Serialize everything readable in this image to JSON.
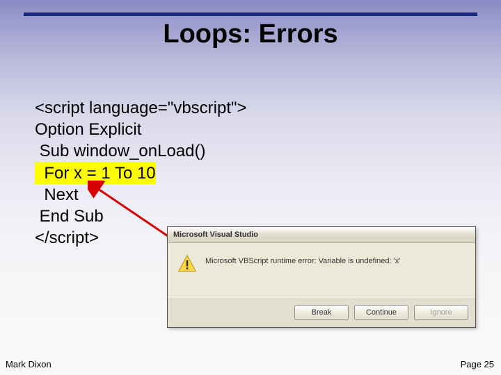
{
  "title": "Loops: Errors",
  "code": {
    "l1": "<script language=\"vbscript\">",
    "l2": "Option Explicit",
    "l3": "",
    "l4": " Sub window_onLoad()",
    "l5_hl": "  For x = 1 To 10",
    "l6": "  Next",
    "l7": " End Sub",
    "l8": "</script>"
  },
  "dialog": {
    "title": "Microsoft Visual Studio",
    "message": "Microsoft VBScript runtime error: Variable is undefined: 'x'",
    "buttons": {
      "break": "Break",
      "cont": "Continue",
      "ignore": "Ignore"
    }
  },
  "footer": {
    "author": "Mark Dixon",
    "page": "Page 25"
  }
}
